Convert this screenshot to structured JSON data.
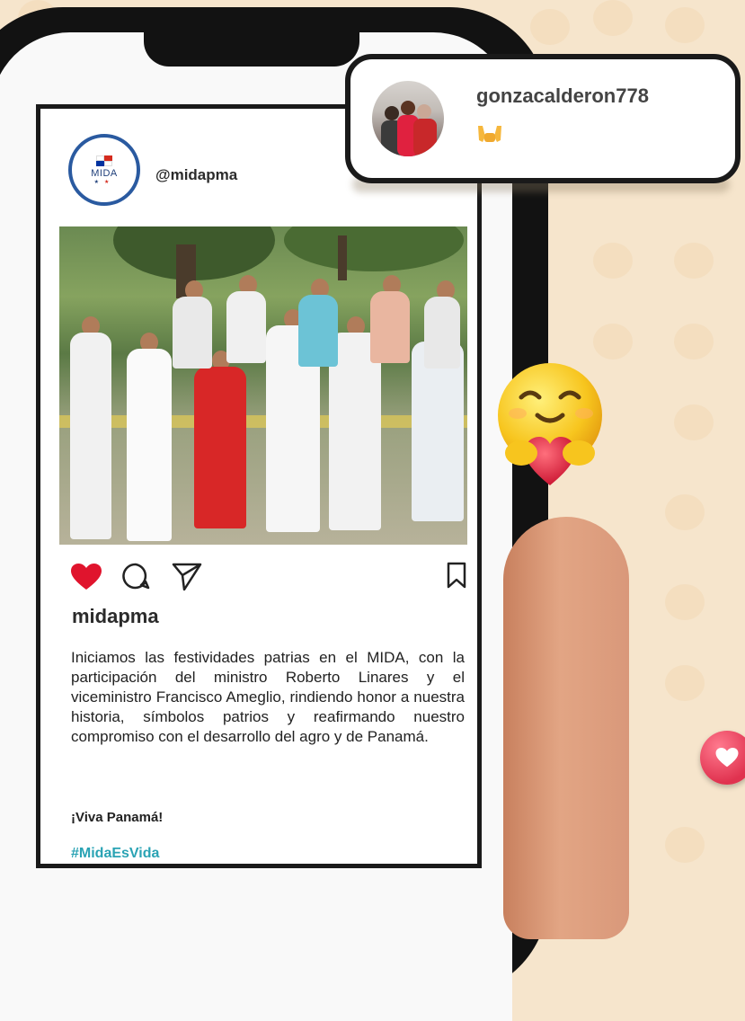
{
  "post": {
    "account_handle_prefix": "@",
    "account_handle": "midapma",
    "logo_text": "MIDA",
    "username": "midapma",
    "caption": "Iniciamos las festividades patrias en el MIDA, con la participación del ministro Roberto Linares y el viceministro Francisco Ameglio, rindiendo honor a nuestra historia, símbolos patrios y reafirmando nuestro compromiso con el desarrollo del agro y de Panamá.",
    "closing": "¡Viva Panamá!",
    "hashtag": "#MidaEsVida",
    "liked": true,
    "icons": [
      "heart-icon",
      "comment-icon",
      "send-icon",
      "bookmark-icon"
    ]
  },
  "comment": {
    "username": "gonzacalderon778",
    "emoji": "raising-hands-emoji"
  },
  "decorations": {
    "hug_emoji": "hugging-face-with-heart-emoji",
    "like_badge": "heart-badge-icon"
  },
  "colors": {
    "background": "#f6e5cc",
    "heart": "#e0142d",
    "hashtag": "#2aa3b4",
    "logo_ring": "#2a5aa0"
  }
}
